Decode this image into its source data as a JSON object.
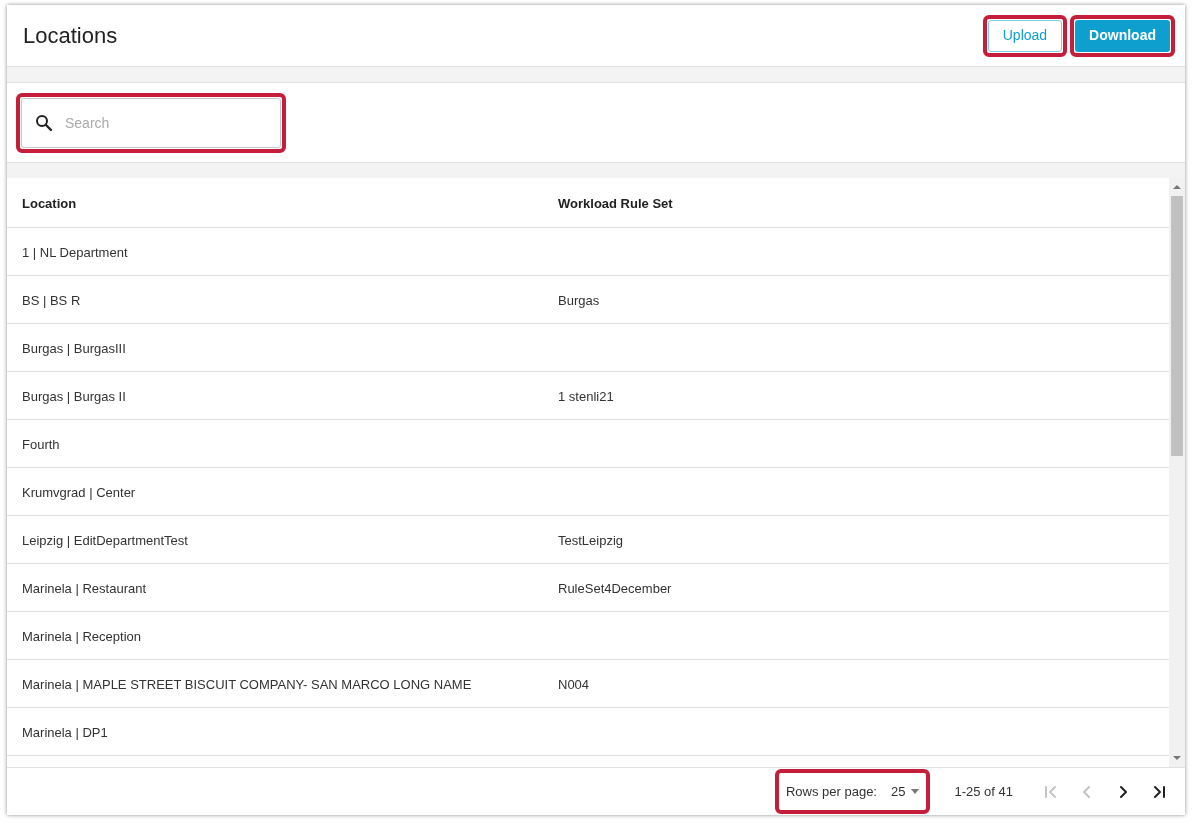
{
  "header": {
    "title": "Locations",
    "buttons": [
      {
        "label": "Upload",
        "kind": "outlined",
        "highlighted": true
      },
      {
        "label": "Download",
        "kind": "filled",
        "highlighted": true
      }
    ]
  },
  "search": {
    "placeholder": "Search",
    "highlighted": true
  },
  "table": {
    "columns": [
      "Location",
      "Workload Rule Set"
    ],
    "rows": [
      [
        "1 | NL Department",
        ""
      ],
      [
        "BS | BS R",
        "Burgas"
      ],
      [
        "Burgas | BurgasIII",
        ""
      ],
      [
        "Burgas | Burgas II",
        "1 stenli21"
      ],
      [
        "Fourth",
        ""
      ],
      [
        "Krumvgrad | Center",
        ""
      ],
      [
        "Leipzig | EditDepartmentTest",
        "TestLeipzig"
      ],
      [
        "Marinela | Restaurant",
        "RuleSet4December"
      ],
      [
        "Marinela | Reception",
        ""
      ],
      [
        "Marinela | MAPLE STREET BISCUIT COMPANY- SAN MARCO LONG NAME",
        "N004"
      ],
      [
        "Marinela | DP1",
        ""
      ]
    ]
  },
  "pagination": {
    "rows_per_page_label": "Rows per page:",
    "rows_per_page": "25",
    "highlighted": true,
    "range": "1-25 of 41",
    "buttons": [
      {
        "kind": "first",
        "disabled": true
      },
      {
        "kind": "prev",
        "disabled": true
      },
      {
        "kind": "next",
        "disabled": false
      },
      {
        "kind": "last",
        "disabled": false
      }
    ]
  }
}
